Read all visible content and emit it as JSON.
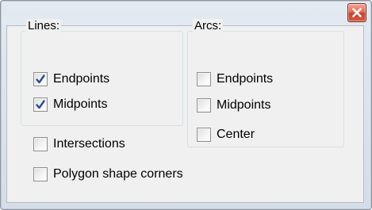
{
  "window": {
    "close_icon": "close-icon"
  },
  "lines": {
    "title": "Lines:",
    "endpoints": {
      "label": "Endpoints",
      "checked": true
    },
    "midpoints": {
      "label": "Midpoints",
      "checked": true
    }
  },
  "arcs": {
    "title": "Arcs:",
    "endpoints": {
      "label": "Endpoints",
      "checked": false
    },
    "midpoints": {
      "label": "Midpoints",
      "checked": false
    },
    "center": {
      "label": "Center",
      "checked": false
    }
  },
  "options": {
    "intersections": {
      "label": "Intersections",
      "checked": false
    },
    "polygon_corners": {
      "label": "Polygon shape corners",
      "checked": false
    }
  },
  "colors": {
    "close_button": "#d85a3f",
    "check_mark": "#2b4a9a",
    "client_background": "#f0f0f0"
  }
}
